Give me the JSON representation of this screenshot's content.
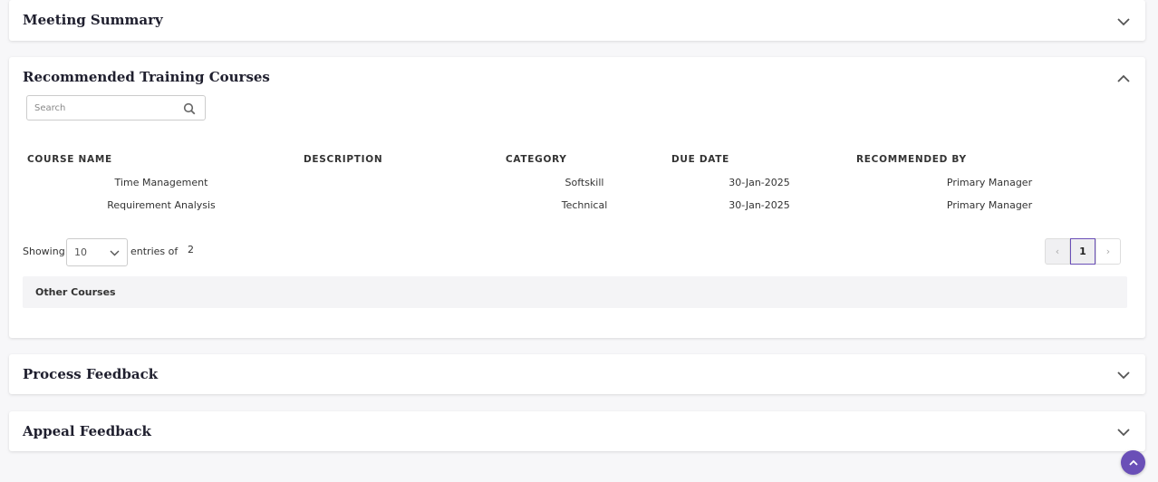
{
  "sections": {
    "meeting_summary": {
      "title": "Meeting Summary"
    },
    "recommended_training": {
      "title": "Recommended Training Courses",
      "search": {
        "placeholder": "Search",
        "value": ""
      },
      "columns": [
        "COURSE NAME",
        "DESCRIPTION",
        "CATEGORY",
        "DUE DATE",
        "RECOMMENDED BY"
      ],
      "rows": [
        {
          "course_name": "Time Management",
          "description": "",
          "category": "Softskill",
          "due_date": "30-Jan-2025",
          "recommended_by": "Primary Manager"
        },
        {
          "course_name": "Requirement Analysis",
          "description": "",
          "category": "Technical",
          "due_date": "30-Jan-2025",
          "recommended_by": "Primary Manager"
        }
      ],
      "pagination": {
        "showing_label": "Showing",
        "page_size": "10",
        "entries_of_label": "entries of",
        "total": "2",
        "prev_symbol": "‹",
        "current_page": "1",
        "next_symbol": "›"
      },
      "other_courses_label": "Other Courses"
    },
    "process_feedback": {
      "title": "Process Feedback"
    },
    "appeal_feedback": {
      "title": "Appeal Feedback"
    }
  },
  "colors": {
    "accent": "#6a4fb7",
    "chevron": "#555555"
  },
  "icons": {
    "expand": "chevron-down-icon",
    "collapse": "chevron-up-icon",
    "search": "search-icon",
    "scroll_top": "chevron-up-icon"
  }
}
